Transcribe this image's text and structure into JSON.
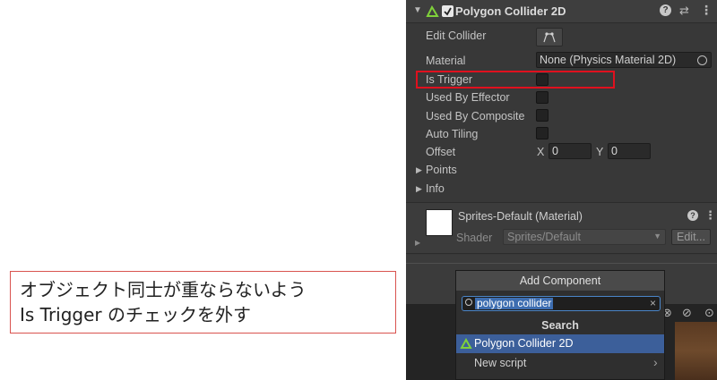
{
  "annotation": {
    "line1": "オブジェクト同士が重ならないよう",
    "line2": "Is Trigger のチェックを外す"
  },
  "inspector": {
    "component_title": "Polygon Collider 2D",
    "rows": {
      "edit_collider": "Edit Collider",
      "material": "Material",
      "material_value": "None (Physics Material 2D)",
      "is_trigger": "Is Trigger",
      "used_by_effector": "Used By Effector",
      "used_by_composite": "Used By Composite",
      "auto_tiling": "Auto Tiling",
      "offset": "Offset",
      "offset_x_label": "X",
      "offset_x": "0",
      "offset_y_label": "Y",
      "offset_y": "0",
      "points": "Points",
      "info": "Info"
    },
    "material_block": {
      "name": "Sprites-Default (Material)",
      "shader_label": "Shader",
      "shader_value": "Sprites/Default",
      "edit_button": "Edit..."
    }
  },
  "add_component": {
    "header": "Add Component",
    "search_value": "polygon collider",
    "search_section": "Search",
    "results": [
      "Polygon Collider 2D",
      "New script"
    ]
  },
  "colors": {
    "highlight": "#e0101e",
    "collider_icon": "#7fd13a",
    "selection": "#3c5f9a"
  }
}
